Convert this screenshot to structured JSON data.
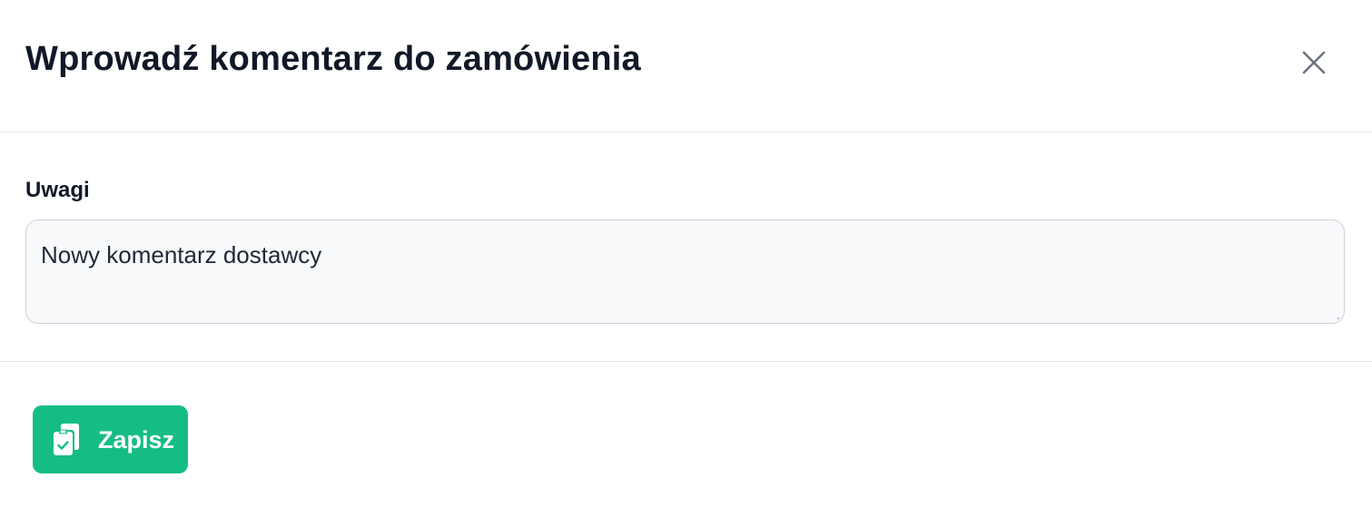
{
  "dialog": {
    "title": "Wprowadź komentarz do zamówienia",
    "close_icon": "close-icon"
  },
  "form": {
    "label": "Uwagi",
    "value": "Nowy komentarz dostawcy"
  },
  "footer": {
    "save_label": "Zapisz",
    "save_icon": "clipboard-check-icon",
    "accent_color": "#16bd83"
  }
}
